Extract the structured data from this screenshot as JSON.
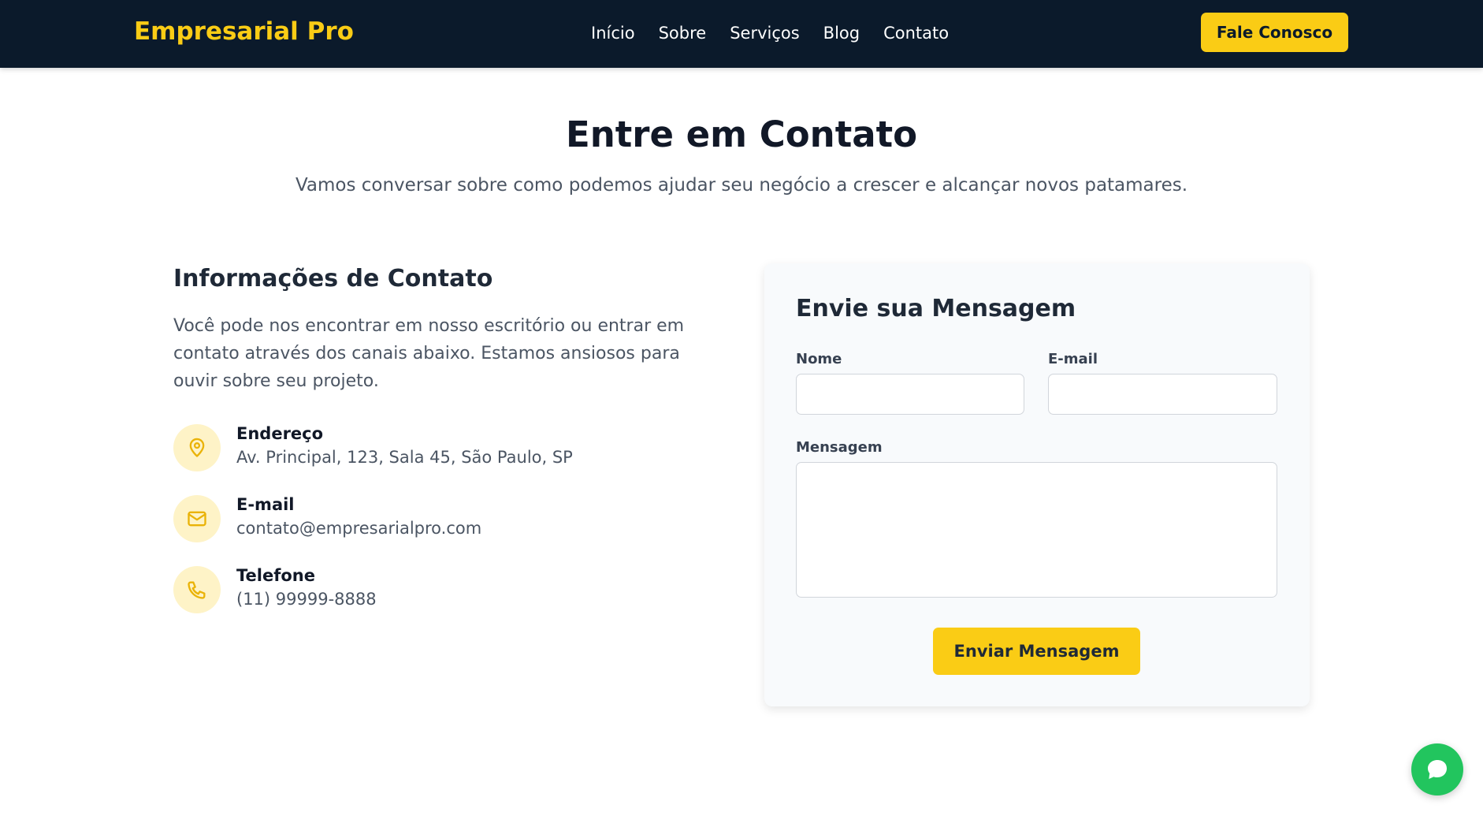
{
  "header": {
    "logo": "Empresarial Pro",
    "nav": [
      "Início",
      "Sobre",
      "Serviços",
      "Blog",
      "Contato"
    ],
    "cta_label": "Fale Conosco"
  },
  "hero": {
    "title": "Entre em Contato",
    "subtitle": "Vamos conversar sobre como podemos ajudar seu negócio a crescer e alcançar novos patamares."
  },
  "contact_info": {
    "title": "Informações de Contato",
    "text": "Você pode nos encontrar em nosso escritório ou entrar em contato através dos canais abaixo. Estamos ansiosos para ouvir sobre seu projeto.",
    "items": [
      {
        "icon": "map-pin-icon",
        "label": "Endereço",
        "value": "Av. Principal, 123, Sala 45, São Paulo, SP"
      },
      {
        "icon": "mail-icon",
        "label": "E-mail",
        "value": "contato@empresarialpro.com"
      },
      {
        "icon": "phone-icon",
        "label": "Telefone",
        "value": "(11) 99999-8888"
      }
    ]
  },
  "form": {
    "title": "Envie sua Mensagem",
    "name_label": "Nome",
    "name_value": "",
    "email_label": "E-mail",
    "email_value": "",
    "message_label": "Mensagem",
    "message_value": "",
    "submit_label": "Enviar Mensagem"
  },
  "colors": {
    "header_bg": "#0b1a2b",
    "accent": "#facc15",
    "icon_bg": "#fef3c7",
    "chat_green": "#22c55e"
  }
}
